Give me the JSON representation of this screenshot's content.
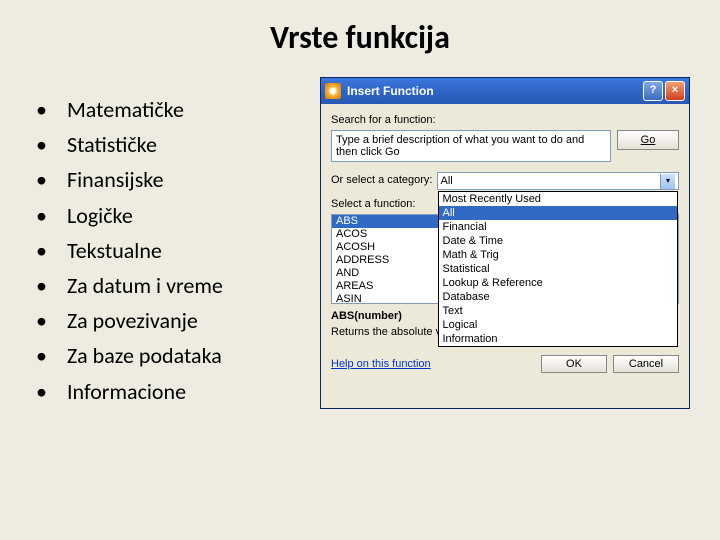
{
  "slide": {
    "title": "Vrste funkcija",
    "bullets": [
      "Matematičke",
      "Statističke",
      "Finansijske",
      "Logičke",
      "Tekstualne",
      "Za datum i vreme",
      "Za povezivanje",
      "Za baze podataka",
      "Informacione"
    ]
  },
  "dialog": {
    "title": "Insert Function",
    "search_label": "Search for a function:",
    "search_text": "Type a brief description of what you want to do and then click Go",
    "go": "Go",
    "category_label": "Or select a category:",
    "category_value": "All",
    "category_options": [
      "Most Recently Used",
      "All",
      "Financial",
      "Date & Time",
      "Math & Trig",
      "Statistical",
      "Lookup & Reference",
      "Database",
      "Text",
      "Logical",
      "Information"
    ],
    "select_func_label": "Select a function:",
    "functions": [
      "ABS",
      "ACOS",
      "ACOSH",
      "ADDRESS",
      "AND",
      "AREAS",
      "ASIN"
    ],
    "syntax": "ABS(number)",
    "description": "Returns the absolute value of a number, a number without its sign.",
    "help_link": "Help on this function",
    "ok": "OK",
    "cancel": "Cancel"
  }
}
